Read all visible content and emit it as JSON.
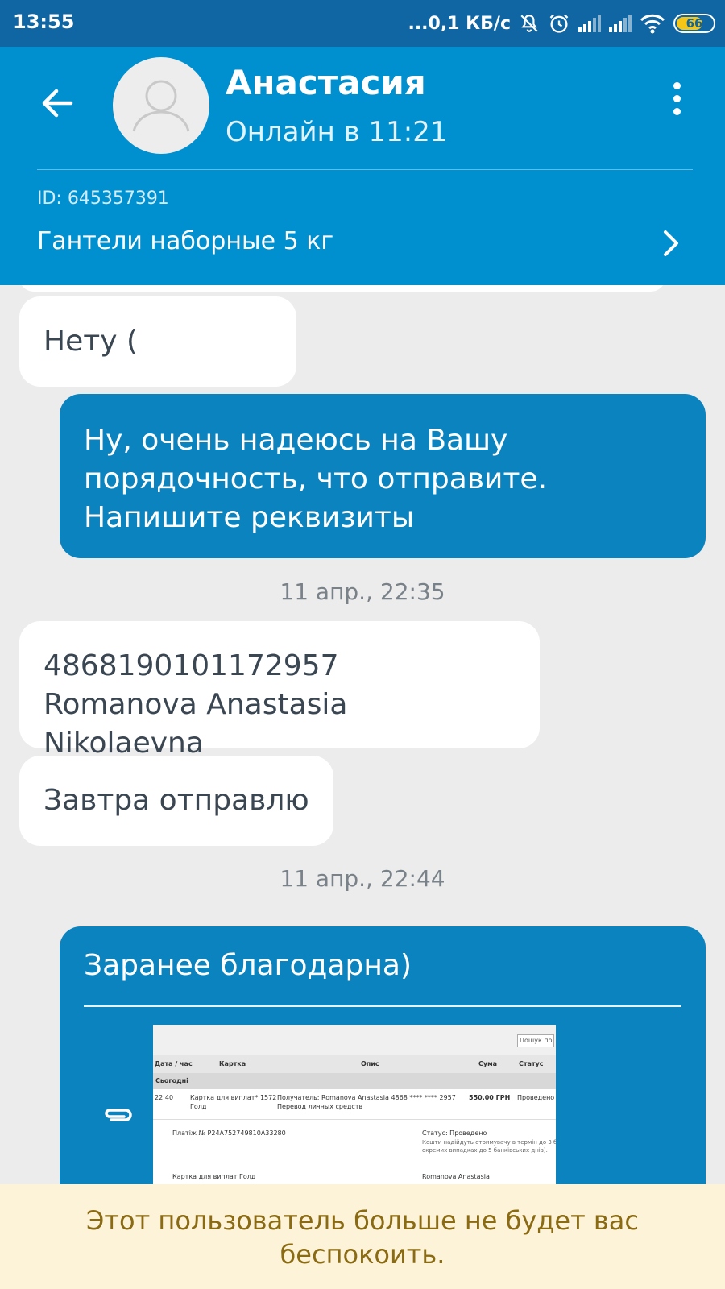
{
  "status_bar": {
    "time": "13:55",
    "network_speed": "...0,1 КБ/с",
    "battery": "66"
  },
  "header": {
    "contact_name": "Анастасия",
    "contact_status": "Онлайн в 11:21",
    "ad_id": "ID: 645357391",
    "ad_title": "Гантели наборные 5 кг",
    "colors": {
      "bar": "#0190cf",
      "status_bar": "#0f66a3"
    }
  },
  "messages": {
    "m1": "Нету (",
    "m2_lines": [
      "Ну, очень надеюсь на Вашу",
      "порядочность, что отправите.",
      "Напишите реквизиты"
    ],
    "ts1": "11 апр., 22:35",
    "m3_lines": [
      "4868190101172957",
      "Romanova Anastasia Nikolaevna"
    ],
    "m4": "Завтра отправлю",
    "ts2": "11 апр., 22:44",
    "m5": "Заранее благодарна)"
  },
  "receipt": {
    "search": "Пошук по",
    "headers": [
      "Дата / час",
      "Картка",
      "Опис",
      "Сума",
      "Статус"
    ],
    "section": "Сьогодні",
    "row": {
      "time": "22:40",
      "card_line1": "Картка для виплат* 1572",
      "card_line2": "Голд",
      "desc_line1": "Получатель: Romanova Anastasia 4868 **** **** 2957",
      "desc_line2": "Перевод личных средств",
      "amount": "550.00 ГРН",
      "status": "Проведено"
    },
    "detail": {
      "payment": "Платіж № P24A752749810A33280",
      "status": "Статус: Проведено",
      "note1": "Кошти надійдуть отримувачу в термін до 3 банк",
      "note2": "окремих випадках до 5 банківських днів).",
      "card_name": "Картка для виплат Голд",
      "recipient": "Romanova Anastasia"
    }
  },
  "banner": {
    "line1": "Этот пользователь больше не будет вас",
    "line2": "беспокоить."
  }
}
